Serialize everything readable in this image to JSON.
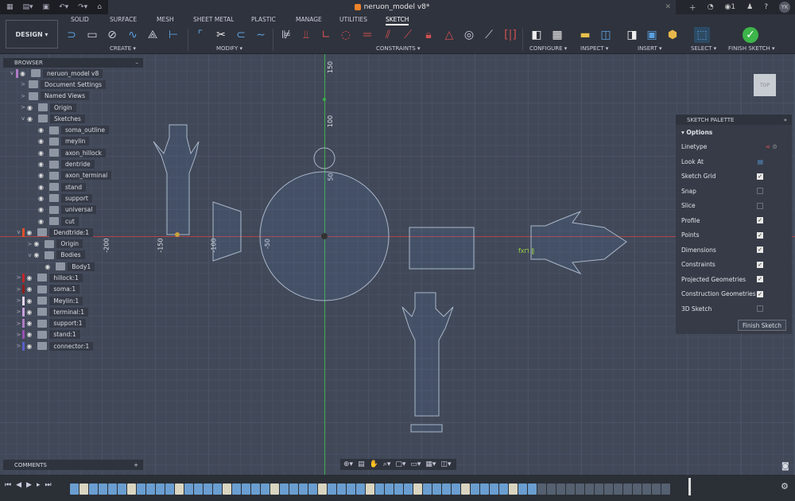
{
  "window": {
    "title": "neruon_model v8*",
    "user_initials": "YK",
    "notifications": "1"
  },
  "workspace": "DESIGN",
  "tabs": [
    "SOLID",
    "SURFACE",
    "MESH",
    "SHEET METAL",
    "PLASTIC",
    "MANAGE",
    "UTILITIES",
    "SKETCH"
  ],
  "active_tab": "SKETCH",
  "groups": [
    "CREATE",
    "MODIFY",
    "CONSTRAINTS",
    "CONFIGURE",
    "INSPECT",
    "INSERT",
    "SELECT",
    "FINISH SKETCH"
  ],
  "browser": {
    "title": "BROWSER",
    "items": [
      {
        "label": "neruon_model v8",
        "depth": 0,
        "chev": "v",
        "eye": true,
        "bar": "#b07cc6"
      },
      {
        "label": "Document Settings",
        "depth": 1,
        "chev": ">",
        "eye": false
      },
      {
        "label": "Named Views",
        "depth": 1,
        "chev": ">",
        "eye": false
      },
      {
        "label": "Origin",
        "depth": 1,
        "chev": ">",
        "eye": true
      },
      {
        "label": "Sketches",
        "depth": 1,
        "chev": "v",
        "eye": true
      },
      {
        "label": "soma_outline",
        "depth": 2,
        "eye": true
      },
      {
        "label": "meylin",
        "depth": 2,
        "eye": true
      },
      {
        "label": "axon_hillock",
        "depth": 2,
        "eye": true
      },
      {
        "label": "dentride",
        "depth": 2,
        "eye": true
      },
      {
        "label": "axon_terminal",
        "depth": 2,
        "eye": true
      },
      {
        "label": "stand",
        "depth": 2,
        "eye": true
      },
      {
        "label": "support",
        "depth": 2,
        "eye": true
      },
      {
        "label": "universal",
        "depth": 2,
        "eye": true
      },
      {
        "label": "cut",
        "depth": 2,
        "eye": true
      },
      {
        "label": "Dendtride:1",
        "depth": 0.6,
        "chev": "v",
        "eye": true,
        "bar": "#e0502a"
      },
      {
        "label": "Origin",
        "depth": 1.6,
        "chev": ">",
        "eye": true
      },
      {
        "label": "Bodies",
        "depth": 1.6,
        "chev": "v",
        "eye": true
      },
      {
        "label": "Body1",
        "depth": 2.6,
        "eye": true
      },
      {
        "label": "hillock:1",
        "depth": 0.6,
        "chev": ">",
        "eye": true,
        "bar": "#c0262a"
      },
      {
        "label": "soma:1",
        "depth": 0.6,
        "chev": ">",
        "eye": true,
        "bar": "#8a1f1a"
      },
      {
        "label": "Meylin:1",
        "depth": 0.6,
        "chev": ">",
        "eye": true,
        "bar": "#e6d8f0"
      },
      {
        "label": "terminal:1",
        "depth": 0.6,
        "chev": ">",
        "eye": true,
        "bar": "#c9a0dc"
      },
      {
        "label": "support:1",
        "depth": 0.6,
        "chev": ">",
        "eye": true,
        "bar": "#b07cc6"
      },
      {
        "label": "stand:1",
        "depth": 0.6,
        "chev": ">",
        "eye": true,
        "bar": "#9a4fb5"
      },
      {
        "label": "connector:1",
        "depth": 0.6,
        "chev": ">",
        "eye": true,
        "bar": "#5a5fc8"
      }
    ]
  },
  "palette": {
    "title": "SKETCH PALETTE",
    "section": "Options",
    "linetype": "Linetype",
    "look_at": "Look At",
    "options": [
      {
        "label": "Sketch Grid",
        "checked": true
      },
      {
        "label": "Snap",
        "checked": false
      },
      {
        "label": "Slice",
        "checked": false
      },
      {
        "label": "Profile",
        "checked": true
      },
      {
        "label": "Points",
        "checked": true
      },
      {
        "label": "Dimensions",
        "checked": true
      },
      {
        "label": "Constraints",
        "checked": true
      },
      {
        "label": "Projected Geometries",
        "checked": true
      },
      {
        "label": "Construction Geometries",
        "checked": true
      },
      {
        "label": "3D Sketch",
        "checked": false
      }
    ],
    "finish_label": "Finish Sketch"
  },
  "comments": {
    "title": "COMMENTS"
  },
  "viewcube": "TOP",
  "axis_labels": {
    "y150": "150",
    "y100": "100",
    "y50": "50",
    "xm50": "-50",
    "xm100": "-100",
    "xm150": "-150",
    "xm200": "-200"
  },
  "colors": {
    "x_axis": "#b0464a",
    "y_axis": "#3cae4a",
    "sketch_line": "#a9b7c9",
    "accent": "#4aa3df"
  }
}
